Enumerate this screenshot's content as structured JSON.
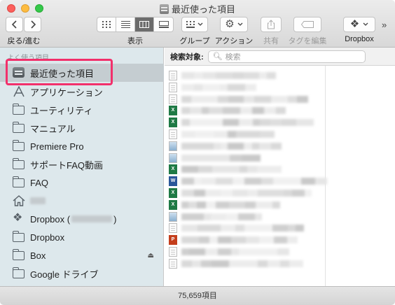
{
  "window": {
    "title": "最近使った項目"
  },
  "toolbar": {
    "back_forward_label": "戻る/進む",
    "view_label": "表示",
    "group_label": "グループ",
    "action_label": "アクション",
    "share_label": "共有",
    "tag_label": "タグを編集",
    "dropbox_label": "Dropbox",
    "active_view": "column"
  },
  "sidebar": {
    "heading": "よく使う項目",
    "items": [
      {
        "label": "最近使った項目",
        "icon": "recents-icon",
        "selected": true
      },
      {
        "label": "アプリケーション",
        "icon": "applications-icon"
      },
      {
        "label": "ユーティリティ",
        "icon": "folder-icon"
      },
      {
        "label": "マニュアル",
        "icon": "folder-icon"
      },
      {
        "label": "Premiere Pro",
        "icon": "folder-icon"
      },
      {
        "label": "サポートFAQ動画",
        "icon": "folder-icon"
      },
      {
        "label": "FAQ",
        "icon": "folder-icon"
      },
      {
        "label": "",
        "icon": "home-icon"
      },
      {
        "label": "Dropbox (",
        "label_suffix": ")",
        "icon": "dropbox-icon"
      },
      {
        "label": "Dropbox",
        "icon": "folder-icon"
      },
      {
        "label": "Box",
        "icon": "folder-icon",
        "ejectable": true
      },
      {
        "label": "Google ドライブ",
        "icon": "folder-icon"
      }
    ]
  },
  "search": {
    "scope_label": "検索対象:",
    "placeholder": "検索"
  },
  "files": [
    {
      "type": "doc"
    },
    {
      "type": "doc"
    },
    {
      "type": "doc"
    },
    {
      "type": "excel"
    },
    {
      "type": "excel"
    },
    {
      "type": "doc"
    },
    {
      "type": "img"
    },
    {
      "type": "img"
    },
    {
      "type": "excel"
    },
    {
      "type": "word"
    },
    {
      "type": "excel"
    },
    {
      "type": "excel"
    },
    {
      "type": "img"
    },
    {
      "type": "doc"
    },
    {
      "type": "ppt"
    },
    {
      "type": "doc"
    },
    {
      "type": "doc"
    }
  ],
  "status": {
    "item_count": "75,659項目"
  },
  "colors": {
    "highlight": "#f2306b",
    "sidebar_bg": "#dde8ec",
    "excel": "#1f7a45",
    "word": "#2b579a",
    "powerpoint": "#c43e1c"
  }
}
